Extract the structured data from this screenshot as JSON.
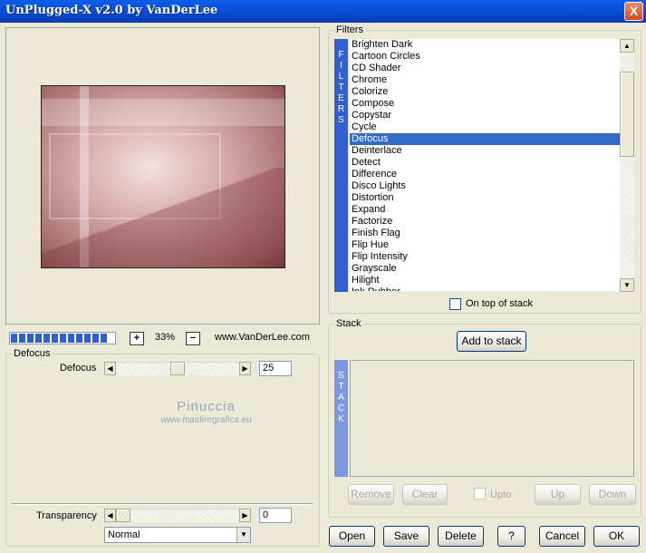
{
  "window": {
    "title": "UnPlugged-X v2.0 by VanDerLee",
    "close_glyph": "X"
  },
  "preview": {
    "zoom_minus": "+",
    "zoom_value": "33%",
    "zoom_plus": "−",
    "website": "www.VanDerLee.com",
    "progress_segments": 12
  },
  "defocus_group": {
    "label": "Defocus",
    "param_label": "Defocus",
    "param_value": "25",
    "slider_fraction": 0.5
  },
  "watermark": {
    "line1": "Pinuccia",
    "line2": "www.maidiregrafica.eu"
  },
  "transparency": {
    "label": "Transparency",
    "value": "0",
    "slider_fraction": 0,
    "blend_mode": "Normal"
  },
  "filters": {
    "group_label": "Filters",
    "vertical_tab": [
      "F",
      "I",
      "L",
      "T",
      "E",
      "R",
      "S"
    ],
    "items": [
      "Brighten Dark",
      "Cartoon Circles",
      "CD Shader",
      "Chrome",
      "Colorize",
      "Compose",
      "Copystar",
      "Cycle",
      "Defocus",
      "Deinterlace",
      "Detect",
      "Difference",
      "Disco Lights",
      "Distortion",
      "Expand",
      "Factorize",
      "Finish Flag",
      "Flip Hue",
      "Flip Intensity",
      "Grayscale",
      "Hilight",
      "Ink Rubber"
    ],
    "selected": "Defocus",
    "on_top_label": "On top of stack"
  },
  "stack": {
    "group_label": "Stack",
    "vertical_tab": [
      "S",
      "T",
      "A",
      "C",
      "K"
    ],
    "add_label": "Add to stack",
    "remove_label": "Remove",
    "clear_label": "Clear",
    "upto_label": "Upto",
    "up_label": "Up",
    "down_label": "Down"
  },
  "bottom_buttons": {
    "open": "Open",
    "save": "Save",
    "delete": "Delete",
    "help": "?",
    "cancel": "Cancel",
    "ok": "OK"
  },
  "colors": {
    "accent": "#2f5fd0",
    "selection": "#316ac5",
    "face": "#ece9d8"
  }
}
